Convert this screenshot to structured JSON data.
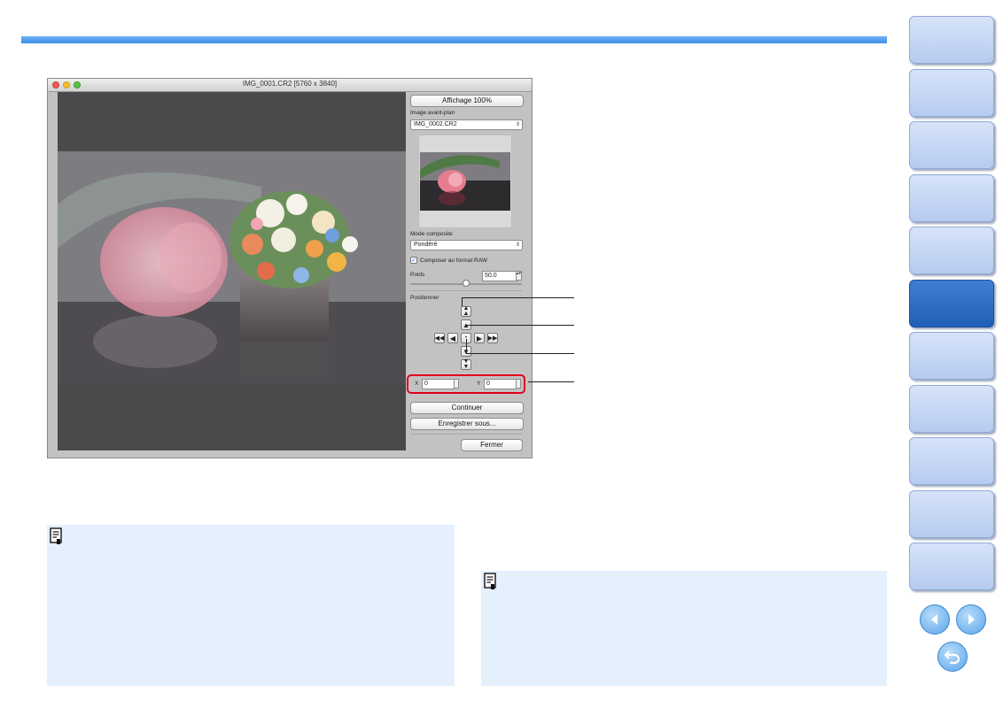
{
  "window": {
    "title": "IMG_0001.CR2 [5760 x 3840]"
  },
  "panel": {
    "view_100_label": "Affichage 100%",
    "foreground_label": "Image avant-plan",
    "foreground_value": "IMG_0002.CR2",
    "composite_mode_label": "Mode composite",
    "composite_mode_value": "Pondéré",
    "raw_checkbox_label": "Composer au format RAW",
    "raw_checked": true,
    "weight_label": "Poids",
    "weight_value": "50.0",
    "weight_level": 0.5,
    "position_label": "Positionner",
    "x_label": "X",
    "x_value": "0",
    "y_label": "Y",
    "y_value": "0",
    "continue_label": "Continuer",
    "save_as_label": "Enregistrer sous...",
    "close_label": "Fermer"
  },
  "colors": {
    "accent": "#3d8fe6",
    "active_tab": "#2a6cc6",
    "highlight": "#e0001a",
    "note_bg": "#e4f0fc"
  },
  "sidebar": {
    "tab_count": 11,
    "active_index": 5
  },
  "icons": [
    "prev-page-icon",
    "next-page-icon",
    "return-icon",
    "note-icon"
  ]
}
